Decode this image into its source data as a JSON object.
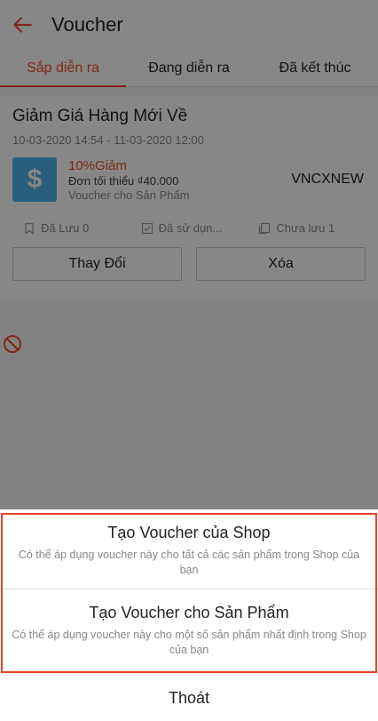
{
  "header": {
    "title": "Voucher",
    "back_icon": "arrow-left-icon"
  },
  "tabs": [
    {
      "label": "Sắp diễn ra",
      "active": true
    },
    {
      "label": "Đang diễn ra",
      "active": false
    },
    {
      "label": "Đã kết thúc",
      "active": false
    }
  ],
  "voucher": {
    "name": "Giảm Giá Hàng Mới Về",
    "date_range": "10-03-2020 14:54 - 11-03-2020 12:00",
    "thumb_symbol": "$",
    "discount": "10%Giảm",
    "min_order": "Đơn tối thiểu ₫40.000",
    "type": "Voucher cho Sản Phẩm",
    "code": "VNCXNEW",
    "stats": {
      "saved": "Đã Lưu 0",
      "used": "Đã sử dụn...",
      "unsaved": "Chưa lưu 1"
    },
    "edit_label": "Thay Đổi",
    "delete_label": "Xóa"
  },
  "sheet": {
    "option1": {
      "title": "Tạo Voucher của Shop",
      "desc": "Có thể áp dụng voucher này cho tất cả các sản phẩm trong Shop của bạn"
    },
    "option2": {
      "title": "Tạo Voucher cho Sản Phẩm",
      "desc": "Có thể áp dụng voucher này cho một số sản phẩm nhất định trong Shop của bạn"
    },
    "cancel_label": "Thoát"
  },
  "colors": {
    "accent": "#ee4d2d",
    "highlight": "#e8432b",
    "thumb": "#4fb3ea"
  }
}
